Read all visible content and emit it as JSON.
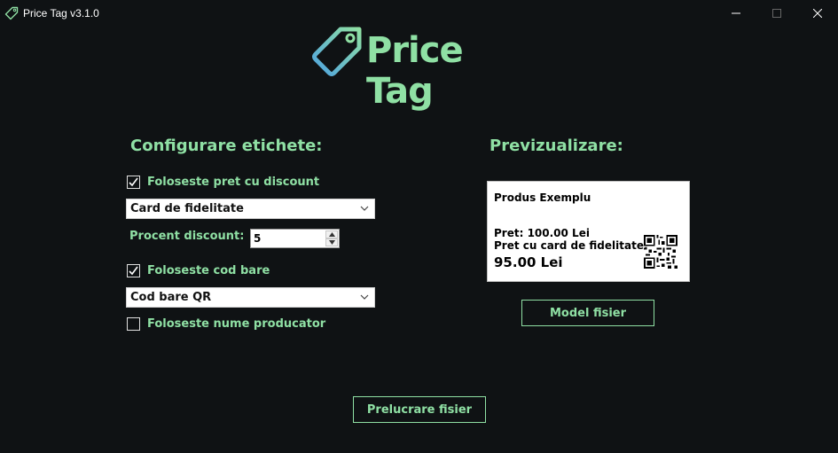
{
  "window": {
    "title": "Price Tag v3.1.0",
    "icon": "tag-icon",
    "controls": [
      "minimize-icon",
      "maximize-icon",
      "close-icon"
    ]
  },
  "logo": {
    "text": "Price Tag",
    "icon": "price-tag-logo-icon"
  },
  "config": {
    "heading": "Configurare etichete:",
    "use_discount": {
      "label": "Foloseste pret cu discount",
      "checked": true
    },
    "discount_type": {
      "value": "Card de fidelitate"
    },
    "discount_percent": {
      "label": "Procent discount:",
      "value": "5"
    },
    "use_barcode": {
      "label": "Foloseste cod bare",
      "checked": true
    },
    "barcode_type": {
      "value": "Cod bare QR"
    },
    "use_producer": {
      "label": "Foloseste nume producator",
      "checked": false
    }
  },
  "preview": {
    "heading": "Previzualizare:",
    "product": "Produs Exemplu",
    "price": "Pret: 100.00 Lei",
    "card_price_label": "Pret cu card de fidelitate:",
    "final_price": "95.00 Lei"
  },
  "buttons": {
    "model": "Model fisier",
    "process": "Prelucrare fisier"
  },
  "colors": {
    "background": "#0f1214",
    "accent": "#8fe0a4",
    "accent_blue": "#4fa3e0"
  }
}
